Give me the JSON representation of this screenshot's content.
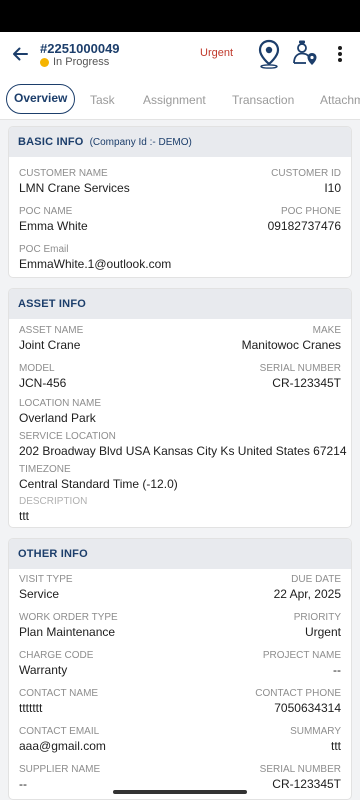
{
  "header": {
    "work_order_number": "#2251000049",
    "status": "In Progress",
    "priority": "Urgent",
    "back_icon": "arrow-left-icon",
    "location_icon": "map-pin-icon",
    "technician_icon": "technician-location-icon",
    "more_icon": "more-vertical-icon"
  },
  "tabs": [
    {
      "label": "Overview",
      "active": true
    },
    {
      "label": "Task"
    },
    {
      "label": "Assignment"
    },
    {
      "label": "Transaction"
    },
    {
      "label": "Attachm"
    }
  ],
  "basic_info": {
    "title": "BASIC INFO",
    "subtitle": "(Company Id :- DEMO)",
    "customer_name_label": "CUSTOMER NAME",
    "customer_name": "LMN Crane Services",
    "customer_id_label": "CUSTOMER ID",
    "customer_id": "I10",
    "poc_name_label": "POC NAME",
    "poc_name": "Emma White",
    "poc_phone_label": "POC PHONE",
    "poc_phone": "09182737476",
    "poc_email_label": "POC Email",
    "poc_email": "EmmaWhite.1@outlook.com"
  },
  "asset_info": {
    "title": "ASSET INFO",
    "asset_name_label": "ASSET NAME",
    "asset_name": "Joint Crane",
    "make_label": "MAKE",
    "make": "Manitowoc Cranes",
    "model_label": "MODEL",
    "model": "JCN-456",
    "serial_number_label": "SERIAL NUMBER",
    "serial_number": "CR-123345T",
    "location_name_label": "LOCATION NAME",
    "location_name": "Overland Park",
    "service_location_label": "SERVICE LOCATION",
    "service_location": "202 Broadway Blvd USA Kansas City Ks United States 67214",
    "timezone_label": "TIMEZONE",
    "timezone": "Central Standard Time (-12.0)",
    "description_label": "DESCRIPTION",
    "description": "ttt"
  },
  "other_info": {
    "title": "OTHER INFO",
    "visit_type_label": "VISIT TYPE",
    "visit_type": "Service",
    "due_date_label": "DUE DATE",
    "due_date": "22 Apr, 2025",
    "work_order_type_label": "WORK ORDER TYPE",
    "work_order_type": "Plan Maintenance",
    "priority_label": "PRIORITY",
    "priority": "Urgent",
    "charge_code_label": "CHARGE CODE",
    "charge_code": "Warranty",
    "project_name_label": "PROJECT NAME",
    "project_name": "--",
    "contact_name_label": "CONTACT NAME",
    "contact_name": "ttttttt",
    "contact_phone_label": "CONTACT PHONE",
    "contact_phone": "7050634314",
    "contact_email_label": "CONTACT EMAIL",
    "contact_email": "aaa@gmail.com",
    "summary_label": "SUMMARY",
    "summary": "ttt",
    "supplier_name_label": "SUPPLIER NAME",
    "supplier_name": "--",
    "serial_number_label": "SERIAL NUMBER",
    "serial_number": "CR-123345T"
  },
  "colors": {
    "brand": "#1c3e6b",
    "urgent": "#c0392b",
    "status_dot": "#f5b400"
  }
}
